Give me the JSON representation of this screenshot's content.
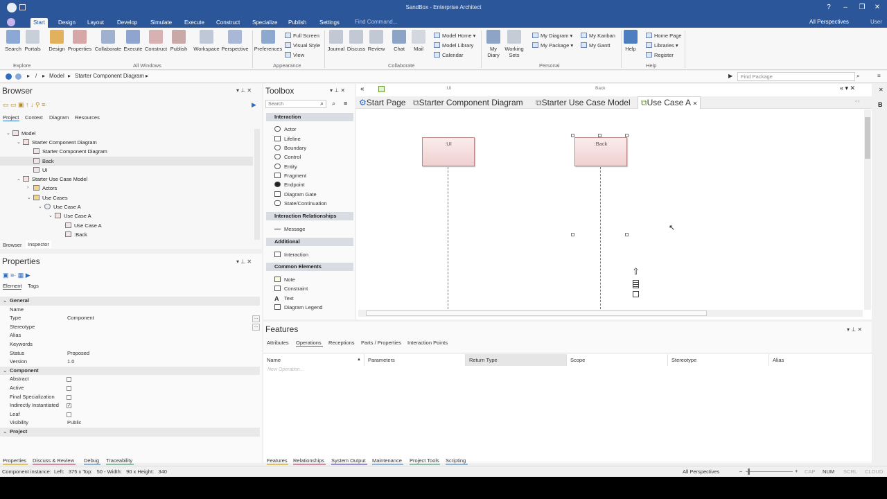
{
  "window": {
    "title": "SandBox - Enterprise Architect",
    "find_command": "Find Command...",
    "perspectives": "All Perspectives",
    "user": "User"
  },
  "ribbon_tabs": [
    "Start",
    "Design",
    "Layout",
    "Develop",
    "Simulate",
    "Execute",
    "Construct",
    "Specialize",
    "Publish",
    "Settings"
  ],
  "ribbon": {
    "buttons": [
      "Search",
      "Portals",
      "Design",
      "Properties",
      "Collaborate",
      "Execute",
      "Construct",
      "Publish",
      "Workspace",
      "Perspective",
      "Preferences",
      "Journal",
      "Discuss",
      "Review",
      "Chat",
      "Mail",
      "My Diary",
      "Working Sets",
      "Help"
    ],
    "appearance_items": [
      "Full Screen",
      "Visual Style",
      "View"
    ],
    "model_items": [
      "Model Home",
      "Model Library",
      "Calendar"
    ],
    "personal_items": [
      "My Diagram",
      "My Package",
      "My Kanban",
      "My Gantt"
    ],
    "help_items": [
      "Home Page",
      "Libraries",
      "Register"
    ],
    "groups": [
      "Explore",
      "All Windows",
      "Appearance",
      "Collaborate",
      "Personal",
      "Help"
    ]
  },
  "address": {
    "crumbs": [
      "/",
      "Model",
      "Starter Component Diagram"
    ],
    "find_package": "Find Package"
  },
  "browser": {
    "title": "Browser",
    "tabs": [
      "Project",
      "Context",
      "Diagram",
      "Resources"
    ],
    "tree": [
      "Model",
      "Starter Component Diagram",
      "Starter Component Diagram",
      "Back",
      "UI",
      "Starter Use Case Model",
      "Actors",
      "Use Cases",
      "Use Case A",
      "Use Case A",
      "Use Case A",
      ":Back"
    ],
    "bottom_tabs": [
      "Browser",
      "Inspector"
    ]
  },
  "properties": {
    "title": "Properties",
    "tabs": [
      "Element",
      "Tags"
    ],
    "rows": [
      {
        "k": "General",
        "v": "",
        "sec": true
      },
      {
        "k": "Name",
        "v": ""
      },
      {
        "k": "Type",
        "v": "Component"
      },
      {
        "k": "Stereotype",
        "v": ""
      },
      {
        "k": "Alias",
        "v": ""
      },
      {
        "k": "Keywords",
        "v": ""
      },
      {
        "k": "Status",
        "v": "Proposed"
      },
      {
        "k": "Version",
        "v": "1.0"
      },
      {
        "k": "Component",
        "v": "",
        "sec": true
      },
      {
        "k": "Abstract",
        "v": "",
        "cb": "0"
      },
      {
        "k": "Active",
        "v": "",
        "cb": "0"
      },
      {
        "k": "Final Specialization",
        "v": "",
        "cb": "0"
      },
      {
        "k": "Indirectly Instantiated",
        "v": "",
        "cb": "1"
      },
      {
        "k": "Leaf",
        "v": "",
        "cb": "0"
      },
      {
        "k": "Visibility",
        "v": "Public"
      },
      {
        "k": "Project",
        "v": "",
        "sec": true
      }
    ],
    "bottom_tabs": [
      "Properties",
      "Discuss & Review",
      "Debug",
      "Traceability"
    ]
  },
  "toolbox": {
    "title": "Toolbox",
    "search_placeholder": "Search",
    "sections": [
      {
        "name": "Interaction",
        "items": [
          "Actor",
          "Lifeline",
          "Boundary",
          "Control",
          "Entity",
          "Fragment",
          "Endpoint",
          "Diagram Gate",
          "State/Continuation"
        ]
      },
      {
        "name": "Interaction Relationships",
        "items": [
          "Message"
        ]
      },
      {
        "name": "Additional",
        "items": [
          "Interaction"
        ]
      },
      {
        "name": "Common Elements",
        "items": [
          "Note",
          "Constraint",
          "Text",
          "Diagram Legend"
        ]
      }
    ]
  },
  "diagram": {
    "header_labels": [
      ":UI",
      "Back"
    ],
    "tabs": [
      "Start Page",
      "Starter Component Diagram",
      "Starter Use Case Model",
      "Use Case A"
    ],
    "lifelines": [
      ":UI",
      ":Back"
    ]
  },
  "features": {
    "title": "Features",
    "tabs": [
      "Attributes",
      "Operations",
      "Receptions",
      "Parts / Properties",
      "Interaction Points"
    ],
    "columns": [
      "Name",
      "Parameters",
      "Return Type",
      "Scope",
      "Stereotype",
      "Alias"
    ],
    "new_row": "New Operation...",
    "bottom_tabs": [
      "Features",
      "Relationships",
      "System Output",
      "Maintenance",
      "Project Tools",
      "Scripting"
    ]
  },
  "status": {
    "left": "Component instance:  Left:   375 x Top:   50 - Width:   90 x Height:   340",
    "persp": "All Perspectives",
    "flags": [
      "CAP",
      "NUM",
      "SCRL",
      "CLOUD"
    ]
  }
}
